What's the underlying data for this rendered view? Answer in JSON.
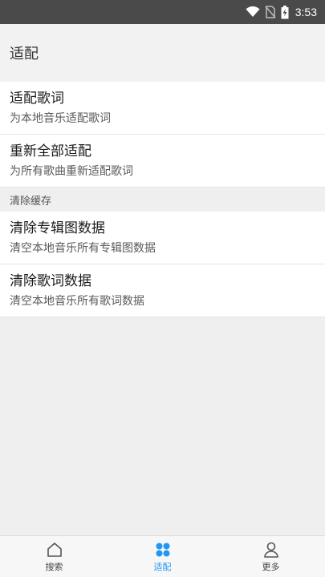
{
  "status_bar": {
    "time": "3:53",
    "icons": [
      "wifi-icon",
      "no-sim-icon",
      "battery-charging-icon"
    ]
  },
  "header": {
    "title": "适配"
  },
  "settings": {
    "items": [
      {
        "title": "适配歌词",
        "subtitle": "为本地音乐适配歌词"
      },
      {
        "title": "重新全部适配",
        "subtitle": "为所有歌曲重新适配歌词"
      }
    ],
    "section_clear": {
      "label": "清除缓存",
      "items": [
        {
          "title": "清除专辑图数据",
          "subtitle": "清空本地音乐所有专辑图数据"
        },
        {
          "title": "清除歌词数据",
          "subtitle": "清空本地音乐所有歌词数据"
        }
      ]
    }
  },
  "bottom_nav": {
    "tabs": [
      {
        "label": "搜索",
        "icon": "home-icon",
        "active": false
      },
      {
        "label": "适配",
        "icon": "grid-dots-icon",
        "active": true
      },
      {
        "label": "更多",
        "icon": "user-icon",
        "active": false
      }
    ],
    "active_color": "#2196f3"
  }
}
